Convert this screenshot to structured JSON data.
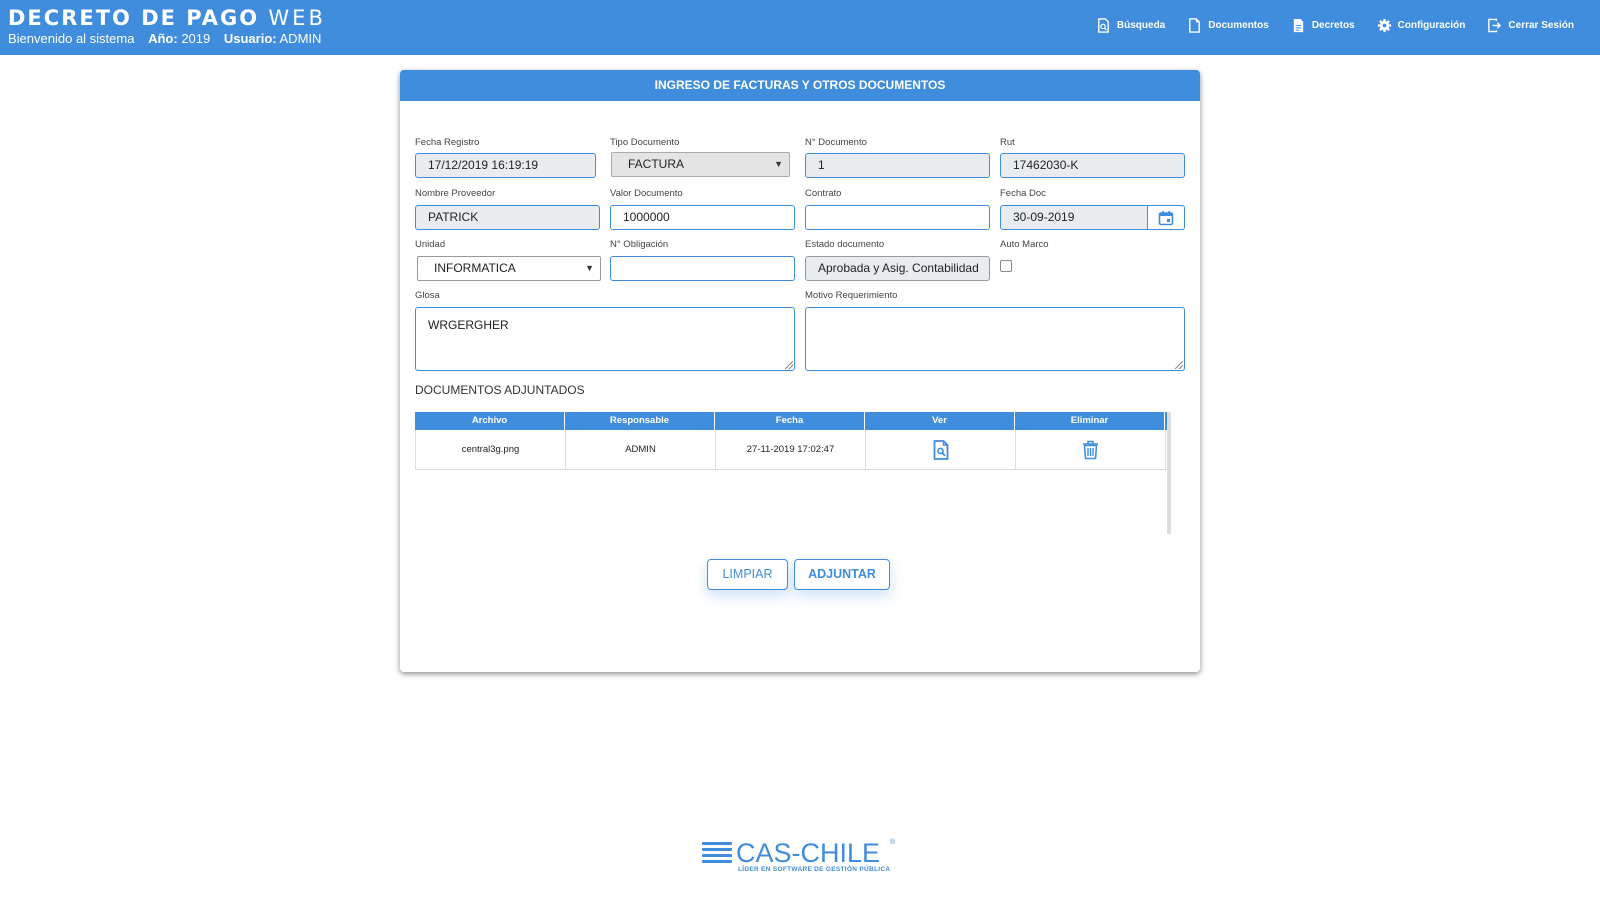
{
  "header": {
    "title_main": "DECRETO DE PAGO",
    "title_web": "WEB",
    "welcome": "Bienvenido al sistema",
    "year_label": "Año:",
    "year": "2019",
    "user_label": "Usuario:",
    "user": "ADMIN",
    "nav": [
      {
        "label": "Búsqueda",
        "icon": "search-doc-icon"
      },
      {
        "label": "Documentos",
        "icon": "document-icon"
      },
      {
        "label": "Decretos",
        "icon": "decree-icon"
      },
      {
        "label": "Configuración",
        "icon": "gear-icon"
      },
      {
        "label": "Cerrar Sesión",
        "icon": "logout-icon"
      }
    ]
  },
  "panel": {
    "title": "INGRESO DE FACTURAS Y OTROS DOCUMENTOS"
  },
  "form": {
    "fecha_registro": {
      "label": "Fecha Registro",
      "value": "17/12/2019 16:19:19"
    },
    "tipo_documento": {
      "label": "Tipo Documento",
      "value": "FACTURA"
    },
    "n_documento": {
      "label": "N° Documento",
      "value": "1"
    },
    "rut": {
      "label": "Rut",
      "value": "17462030-K"
    },
    "nombre_proveedor": {
      "label": "Nombre Proveedor",
      "value": "PATRICK"
    },
    "valor_documento": {
      "label": "Valor Documento",
      "value": "1000000"
    },
    "contrato": {
      "label": "Contrato",
      "value": ""
    },
    "fecha_doc": {
      "label": "Fecha Doc",
      "value": "30-09-2019"
    },
    "unidad": {
      "label": "Unidad",
      "value": "INFORMATICA"
    },
    "n_obligacion": {
      "label": "N° Obligación",
      "value": ""
    },
    "estado_documento": {
      "label": "Estado documento",
      "value": "Aprobada y Asig. Contabilidad"
    },
    "auto_marco": {
      "label": "Auto Marco",
      "checked": false
    },
    "glosa": {
      "label": "Glosa",
      "value": "WRGERGHER"
    },
    "motivo": {
      "label": "Motivo Requerimiento",
      "value": ""
    }
  },
  "attachments": {
    "title": "DOCUMENTOS ADJUNTADOS",
    "columns": [
      "Archivo",
      "Responsable",
      "Fecha",
      "Ver",
      "Eliminar"
    ],
    "rows": [
      {
        "archivo": "central3g.png",
        "responsable": "ADMIN",
        "fecha": "27-11-2019 17:02:47"
      }
    ]
  },
  "buttons": {
    "limpiar": "LIMPIAR",
    "adjuntar": "ADJUNTAR"
  },
  "footer": {
    "logo_text": "CAS-CHILE",
    "logo_reg": "®",
    "tagline": "LÍDER EN SOFTWARE DE GESTIÓN PÚBLICA"
  },
  "colors": {
    "primary": "#3f8ddc",
    "readonly_bg": "#e9ecef"
  }
}
